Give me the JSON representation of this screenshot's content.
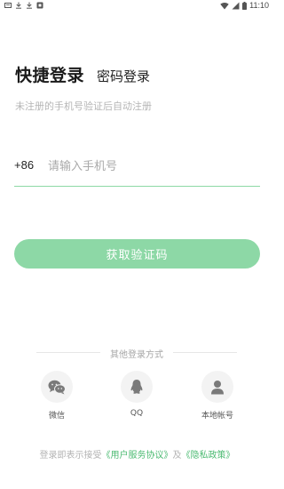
{
  "status_bar": {
    "time": "11:10",
    "left_icons": [
      "notification-icon",
      "download-icon",
      "download-icon",
      "app-icon"
    ],
    "right_icons": [
      "wifi-icon",
      "signal-icon",
      "battery-icon"
    ]
  },
  "tabs": {
    "quick_login": "快捷登录",
    "password_login": "密码登录"
  },
  "subtitle": "未注册的手机号验证后自动注册",
  "phone": {
    "prefix": "+86",
    "placeholder": "请输入手机号",
    "value": ""
  },
  "get_code_button": "获取验证码",
  "other_login": {
    "title": "其他登录方式",
    "options": [
      {
        "label": "微信",
        "icon": "wechat-icon"
      },
      {
        "label": "QQ",
        "icon": "qq-icon"
      },
      {
        "label": "本地帐号",
        "icon": "user-icon"
      }
    ]
  },
  "agreement": {
    "prefix": "登录即表示接受",
    "user_agreement": "《用户服务协议》",
    "and": "及",
    "privacy_policy": "《隐私政策》"
  },
  "colors": {
    "accent": "#8dd8a6",
    "link": "#4dbb73",
    "icon_gray": "#7a7a7a"
  }
}
